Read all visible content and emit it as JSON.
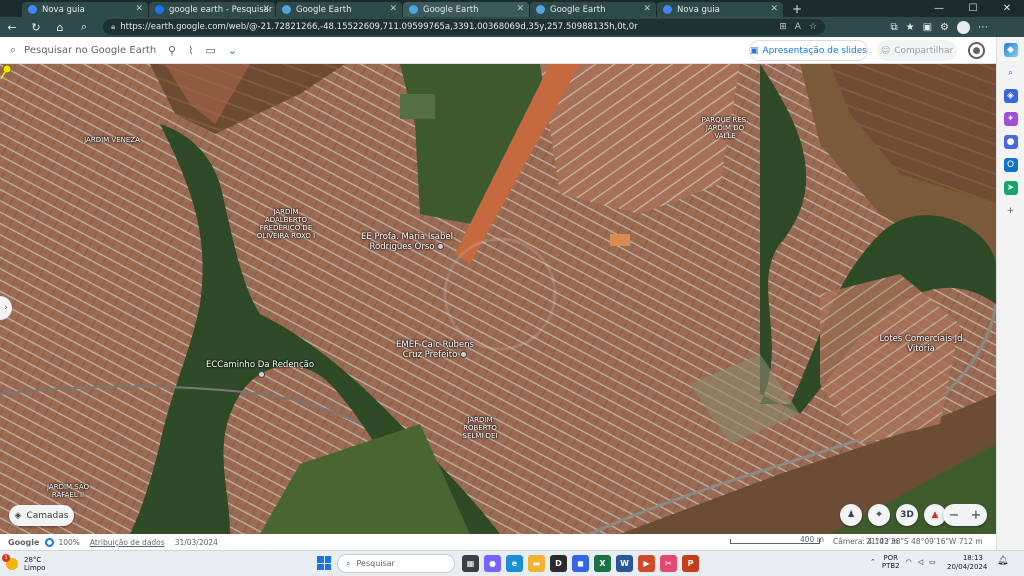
{
  "browser": {
    "tabs": [
      {
        "title": "Nova guia",
        "favicon_color": "#4285f4",
        "active": false
      },
      {
        "title": "google earth - Pesquisar",
        "favicon_color": "#1a73e8",
        "active": false
      },
      {
        "title": "Google Earth",
        "favicon_color": "#4fa3e0",
        "active": false
      },
      {
        "title": "Google Earth",
        "favicon_color": "#4fa3e0",
        "active": true
      },
      {
        "title": "Google Earth",
        "favicon_color": "#4fa3e0",
        "active": false
      },
      {
        "title": "Nova guia",
        "favicon_color": "#4285f4",
        "active": false
      }
    ],
    "new_tab": "+",
    "url": "https://earth.google.com/web/@-21.72821266,-48.15522609,711.09599765a,3391.00368069d,35y,257.50988135h,0t,0r"
  },
  "earth": {
    "search_placeholder": "Pesquisar no Google Earth",
    "slides_label": "Apresentação de slides",
    "share_label": "Compartilhar",
    "layers_label": "Camadas",
    "mode_3d": "3D"
  },
  "map": {
    "neighborhoods": [
      {
        "id": "jardim-veneza",
        "text": "JARDIM VENEZA"
      },
      {
        "id": "jardim-adalberto",
        "text": "JARDIM ADALBERTO FREDERICO DE OLIVEIRA ROXO I"
      },
      {
        "id": "parque-jardim-do-valle",
        "text": "PARQUE RES. JARDIM DO VALLE"
      },
      {
        "id": "jardim-roberto-selmi",
        "text": "JARDIM ROBERTO SELMI DEI"
      },
      {
        "id": "jardim-sao-rafael",
        "text": "JARDIM SÃO RAFAEL II"
      }
    ],
    "pois": [
      {
        "id": "ee-profa-maria",
        "text": "EE Profa. Maria Isabel Rodrigues Orso"
      },
      {
        "id": "emef-caic",
        "text": "EMEF Caic Rubens Cruz Prefeito"
      },
      {
        "id": "ec-caminho",
        "text": "ECCaminho Da Redenção"
      },
      {
        "id": "lotes-comerciais",
        "text": "Lotes Comerciais Jd Vitória"
      }
    ]
  },
  "status": {
    "brand": "Google",
    "progress": "100%",
    "credits": "Atribuição de dados",
    "date": "31/03/2024",
    "scale": "400 m",
    "camera": "Câmera: 4.102 m",
    "coords": "21°43'38\"S 48°09'16\"W  712 m"
  },
  "taskbar": {
    "temperature": "28°C",
    "weather": "Limpo",
    "weather_badge": "1",
    "search_placeholder": "Pesquisar",
    "lang": "POR",
    "layout": "PTB2",
    "time": "18:13",
    "date": "20/04/2024"
  },
  "colors": {
    "tab_bar": "#1c2b2c",
    "nav_bar": "#2f4a4b",
    "accent": "#1a73e8",
    "pin": "#f2e600"
  }
}
